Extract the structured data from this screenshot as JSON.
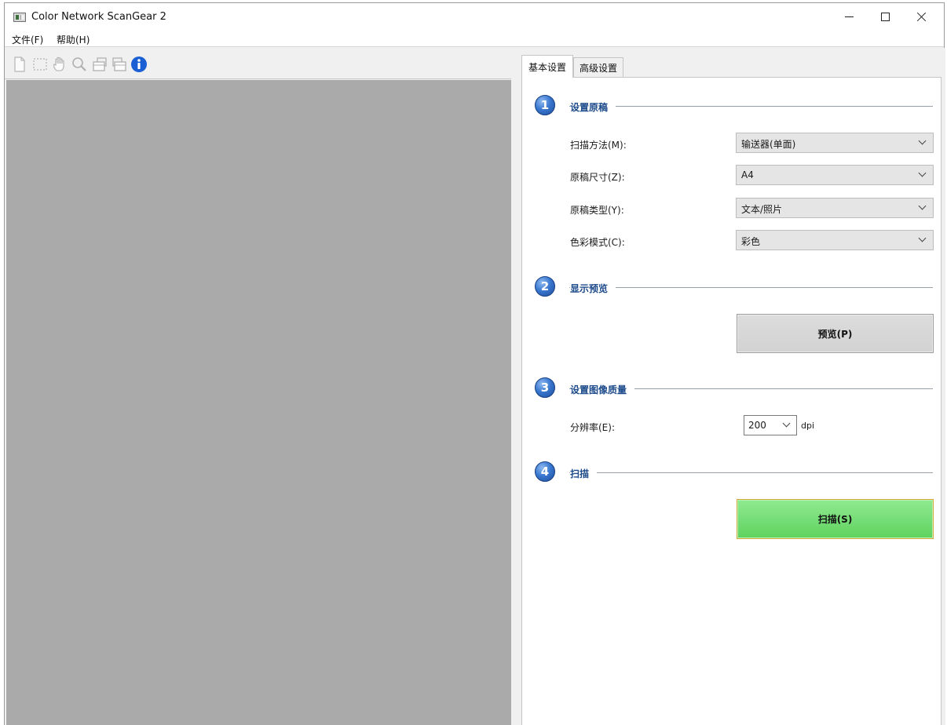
{
  "window": {
    "title": "Color Network ScanGear 2",
    "controls": [
      "minimize-icon",
      "maximize-icon",
      "close-icon"
    ]
  },
  "menu": {
    "items": [
      {
        "label": "文件(F)"
      },
      {
        "label": "帮助(H)"
      }
    ]
  },
  "toolbar": {
    "icons": [
      "new-page-icon",
      "select-area-icon",
      "hand-icon",
      "zoom-icon",
      "rotate-left-icon",
      "rotate-right-icon",
      "info-icon"
    ],
    "info_color": "#1a5fd4"
  },
  "tabs": [
    {
      "label": "基本设置",
      "active": true
    },
    {
      "label": "高级设置",
      "active": false
    }
  ],
  "sections": [
    {
      "number": "1",
      "title": "设置原稿"
    },
    {
      "number": "2",
      "title": "显示预览"
    },
    {
      "number": "3",
      "title": "设置图像质量"
    },
    {
      "number": "4",
      "title": "扫描"
    }
  ],
  "fields": {
    "scan_method": {
      "label": "扫描方法(M):",
      "value": "输送器(单面)"
    },
    "doc_size": {
      "label": "原稿尺寸(Z):",
      "value": "A4"
    },
    "doc_type": {
      "label": "原稿类型(Y):",
      "value": "文本/照片"
    },
    "color_mode": {
      "label": "色彩模式(C):",
      "value": "彩色"
    },
    "resolution": {
      "label": "分辨率(E):",
      "value": "200",
      "unit": "dpi"
    }
  },
  "buttons": {
    "preview": "预览(P)",
    "scan": "扫描(S)"
  },
  "colors": {
    "preview_area": "#aaaaaa",
    "section_title": "#1c4a8a",
    "scan_button": "#6fdc6f",
    "scan_border": "#d4a935"
  }
}
